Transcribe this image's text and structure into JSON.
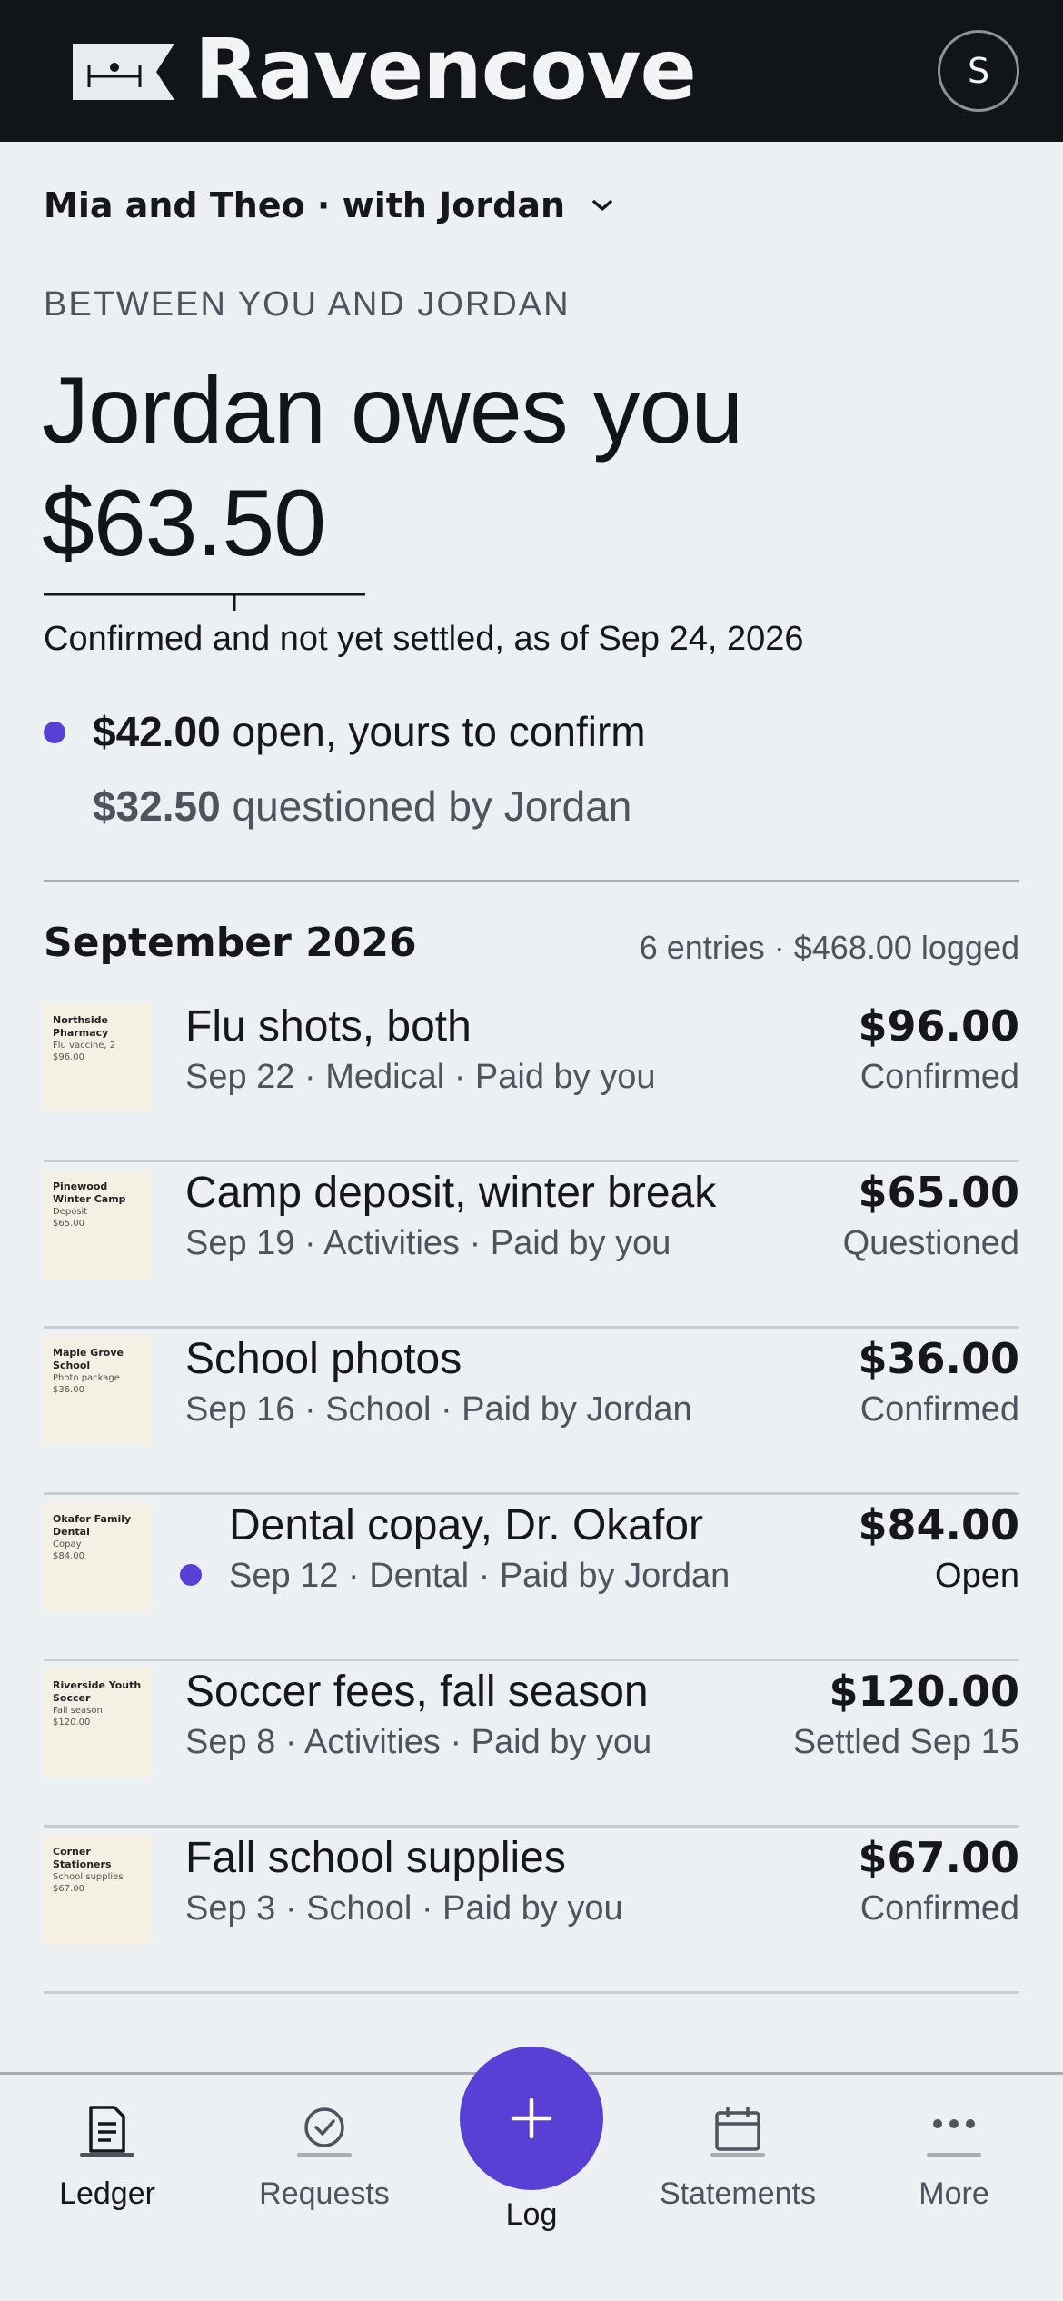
{
  "app": {
    "brand": "Ravencove",
    "avatar_initial": "S"
  },
  "selector": {
    "label": "Mia and Theo · with Jordan"
  },
  "balance": {
    "eyebrow": "BETWEEN YOU AND JORDAN",
    "headline_line1": "Jordan owes you",
    "headline_amount": "$63.50",
    "as_of": "Confirmed and not yet settled, as of Sep 24, 2026",
    "open_amount": "$42.00",
    "open_text": " open, yours to confirm",
    "questioned_amount": "$32.50",
    "questioned_text": " questioned by Jordan"
  },
  "month": {
    "title": "September 2026",
    "summary": "6 entries · $468.00 logged"
  },
  "entries": [
    {
      "title": "Flu shots, both",
      "meta": "Sep 22 · Medical · Paid by you",
      "amount": "$96.00",
      "status": "Confirmed",
      "receipt_vendor": "Northside Pharmacy",
      "receipt_item": "Flu vaccine, 2",
      "receipt_amount": "$96.00"
    },
    {
      "title": "Camp deposit, winter break",
      "meta": "Sep 19 · Activities · Paid by you",
      "amount": "$65.00",
      "status": "Questioned",
      "receipt_vendor": "Pinewood Winter Camp",
      "receipt_item": "Deposit",
      "receipt_amount": "$65.00"
    },
    {
      "title": "School photos",
      "meta": "Sep 16 · School · Paid by Jordan",
      "amount": "$36.00",
      "status": "Confirmed",
      "receipt_vendor": "Maple Grove School",
      "receipt_item": "Photo package",
      "receipt_amount": "$36.00"
    },
    {
      "title": "Dental copay, Dr. Okafor",
      "meta": "Sep 12 · Dental · Paid by Jordan",
      "amount": "$84.00",
      "status": "Open",
      "receipt_vendor": "Okafor Family Dental",
      "receipt_item": "Copay",
      "receipt_amount": "$84.00"
    },
    {
      "title": "Soccer fees, fall season",
      "meta": "Sep 8 · Activities · Paid by you",
      "amount": "$120.00",
      "status": "Settled Sep 15",
      "receipt_vendor": "Riverside Youth Soccer",
      "receipt_item": "Fall season",
      "receipt_amount": "$120.00"
    },
    {
      "title": "Fall school supplies",
      "meta": "Sep 3 · School · Paid by you",
      "amount": "$67.00",
      "status": "Confirmed",
      "receipt_vendor": "Corner Stationers",
      "receipt_item": "School supplies",
      "receipt_amount": "$67.00"
    }
  ],
  "tabs": {
    "ledger": "Ledger",
    "requests": "Requests",
    "log": "Log",
    "statements": "Statements",
    "more": "More"
  },
  "colors": {
    "accent": "#5a3fd6",
    "topbar": "#111418",
    "background": "#edf0f3"
  },
  "icons": [
    "logo-flag-icon",
    "chevron-down-icon",
    "ledger-icon",
    "check-circle-icon",
    "plus-icon",
    "calendar-icon",
    "more-dots-icon"
  ]
}
